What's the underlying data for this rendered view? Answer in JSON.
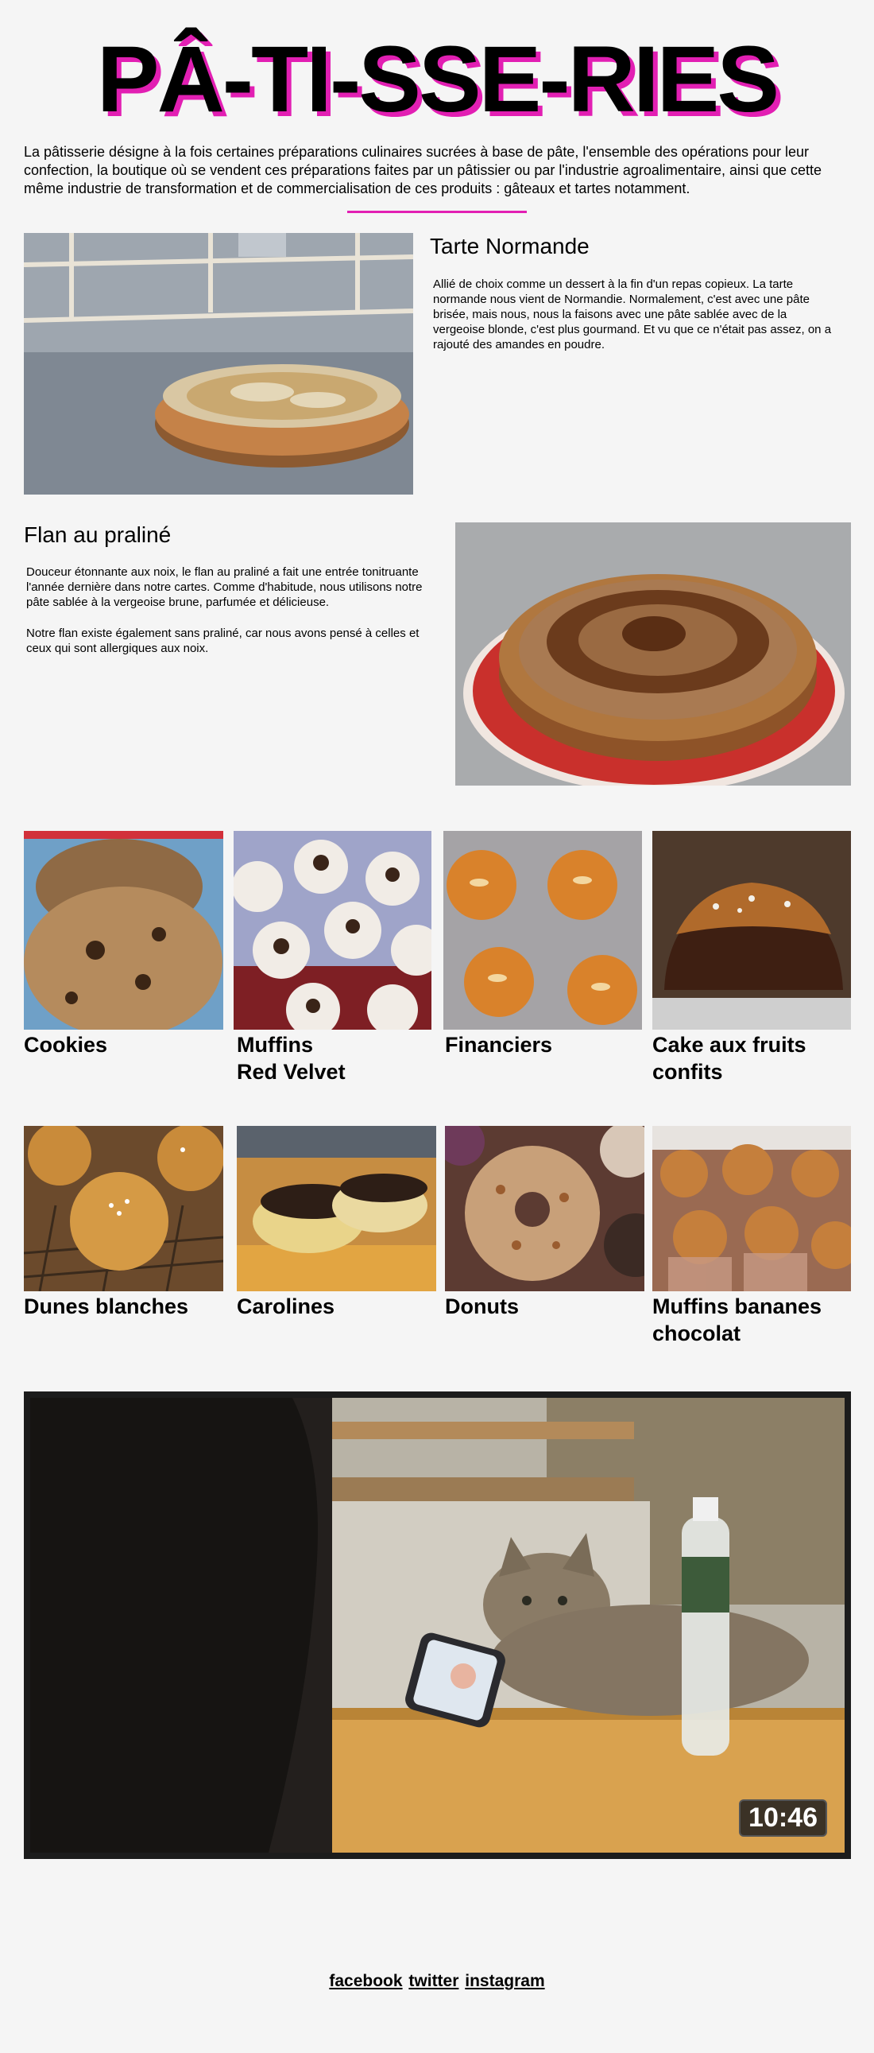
{
  "header": {
    "title": "PÂ-TI-SSE-RIES",
    "intro": "La pâtisserie désigne à la fois certaines préparations culinaires sucrées à base de pâte, l'ensemble des opérations pour leur confection, la boutique où se vendent ces préparations faites par un pâtissier ou par l'industrie agroalimentaire, ainsi que cette même industrie de transformation et de commercialisation de ces produits : gâteaux et tartes notamment.",
    "accent_color": "#e21fb3"
  },
  "features": [
    {
      "title": "Tarte Normande",
      "text": "Allié de choix comme un dessert à la fin d'un repas copieux. La tarte normande nous vient de Normandie. Normalement, c'est avec une pâte brisée, mais nous, nous la faisons avec une pâte sablée avec de la vergeoise blonde, c'est plus gourmand. Et vu que ce n'était pas assez, on a rajouté des amandes en poudre.",
      "image": "tarte-normande-photo"
    },
    {
      "title": "Flan au praliné",
      "text": "Douceur étonnante aux noix, le flan au praliné a fait une entrée tonitruante l'année dernière dans notre cartes. Comme d'habitude, nous utilisons notre pâte sablée à la vergeoise brune, parfumée et délicieuse.",
      "text2": "Notre flan existe également sans praliné, car nous avons pensé à celles et ceux qui sont allergiques aux noix.",
      "image": "flan-praline-photo"
    }
  ],
  "gallery_row1": [
    {
      "label": "Cookies"
    },
    {
      "label": "Muffins",
      "label2": "Red Velvet"
    },
    {
      "label": "Financiers"
    },
    {
      "label": "Cake aux fruits",
      "label2": "confits"
    }
  ],
  "gallery_row2": [
    {
      "label": "Dunes blanches"
    },
    {
      "label": "Carolines"
    },
    {
      "label": "Donuts"
    },
    {
      "label": "Muffins bananes",
      "label2": "chocolat"
    }
  ],
  "video": {
    "duration": "10:46"
  },
  "footer": {
    "links": [
      "facebook",
      "twitter",
      "instagram"
    ]
  }
}
